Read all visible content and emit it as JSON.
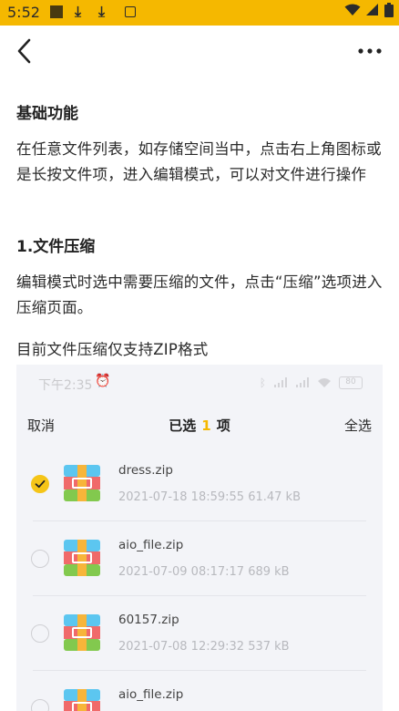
{
  "status_bar": {
    "time": "5:52"
  },
  "article": {
    "heading": "基础功能",
    "paragraph1": "在任意文件列表，如存储空间当中，点击右上角图标或是长按文件项，进入编辑模式，可以对文件进行操作",
    "section_title": "1.文件压缩",
    "paragraph2": "编辑模式时选中需要压缩的文件，点击“压缩”选项进入压缩页面。",
    "paragraph3": "目前文件压缩仅支持ZIP格式"
  },
  "screenshot": {
    "status_time": "下午2:35",
    "battery": "80",
    "cancel_label": "取消",
    "title_prefix": "已选",
    "selected_count": "1",
    "title_suffix": "项",
    "select_all_label": "全选",
    "files": [
      {
        "name": "dress.zip",
        "meta": "2021-07-18 18:59:55   61.47 kB",
        "checked": true
      },
      {
        "name": "aio_file.zip",
        "meta": "2021-07-09 08:17:17   689 kB",
        "checked": false
      },
      {
        "name": "60157.zip",
        "meta": "2021-07-08 12:29:32   537 kB",
        "checked": false
      },
      {
        "name": "aio_file.zip",
        "meta": "",
        "checked": false
      }
    ]
  },
  "colors": {
    "accent": "#f5b800"
  }
}
